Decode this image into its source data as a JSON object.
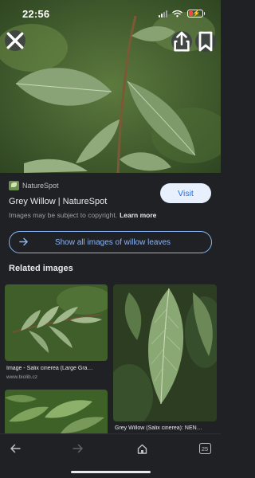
{
  "status_bar": {
    "time": "22:56"
  },
  "hero": {
    "close_icon": "close-icon",
    "share_icon": "share-icon",
    "bookmark_icon": "bookmark-icon"
  },
  "result": {
    "source_name": "NatureSpot",
    "title": "Grey Willow | NatureSpot",
    "copyright_notice": "Images may be subject to copyright.",
    "learn_more_label": "Learn more",
    "visit_label": "Visit"
  },
  "show_all": {
    "label": "Show all images of willow leaves",
    "icon": "arrow-right-icon"
  },
  "related": {
    "heading": "Related images",
    "items": [
      {
        "caption": "Image - Salix cinerea (Large Gra…",
        "source": "www.biolib.cz"
      },
      {
        "caption": "Grey Willow (Salix cinerea): NEN…",
        "source": ""
      },
      {
        "caption": "",
        "source": ""
      }
    ]
  },
  "bottom_bar": {
    "back_icon": "arrow-left-icon",
    "forward_icon": "arrow-right-icon",
    "home_icon": "home-icon",
    "tab_count": "25"
  },
  "colors": {
    "accent": "#8ab4f8",
    "background": "#202124",
    "visit_button_bg": "#e8f0fe",
    "battery_low": "#ff453a"
  }
}
